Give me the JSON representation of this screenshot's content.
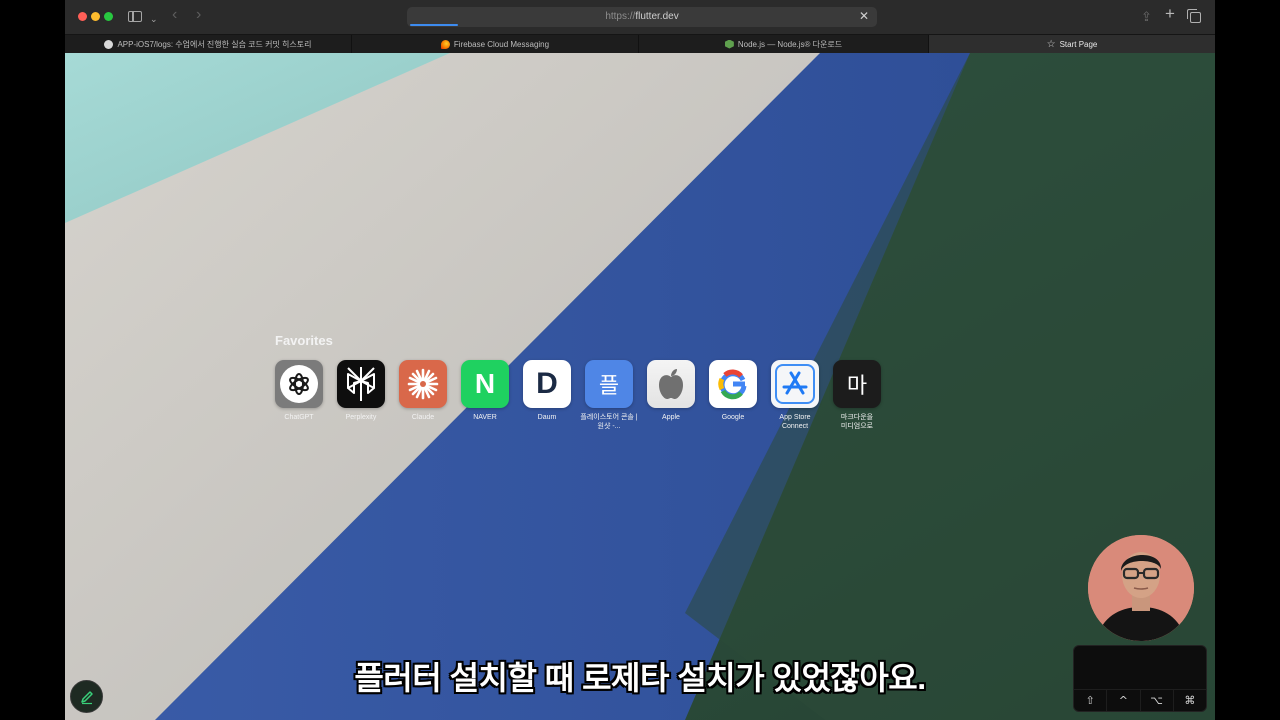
{
  "browser": {
    "address": {
      "scheme": "https://",
      "host": "flutter.dev"
    },
    "tabs": [
      {
        "label": "APP-iOS7/logs: 수업에서 진행한 실습 코드 커밋 히스토리",
        "icon": "github-icon"
      },
      {
        "label": "Firebase Cloud Messaging",
        "icon": "firebase-icon"
      },
      {
        "label": "Node.js — Node.js® 다운로드",
        "icon": "nodejs-icon"
      },
      {
        "label": "Start Page",
        "icon": "star-icon",
        "active": true
      }
    ]
  },
  "start_page": {
    "favorites_title": "Favorites",
    "favorites": [
      {
        "label": "ChatGPT",
        "icon": "chatgpt-icon"
      },
      {
        "label": "Perplexity",
        "icon": "perplexity-icon"
      },
      {
        "label": "Claude",
        "icon": "claude-icon"
      },
      {
        "label": "NAVER",
        "icon": "naver-icon",
        "glyph": "N"
      },
      {
        "label": "Daum",
        "icon": "daum-icon",
        "glyph": "D"
      },
      {
        "label": "플레이스토어 콘솔 | 원샷 -...",
        "icon": "playstore-console-icon",
        "glyph": "플"
      },
      {
        "label": "Apple",
        "icon": "apple-icon"
      },
      {
        "label": "Google",
        "icon": "google-icon",
        "glyph": "G"
      },
      {
        "label": "App Store Connect",
        "icon": "app-store-connect-icon"
      },
      {
        "label": "마크다운을 미디엄으로",
        "icon": "markdown-medium-icon",
        "glyph": "마"
      }
    ]
  },
  "video": {
    "subtitle": "플러터 설치할 때 로제타 설치가 있었잖아요."
  },
  "key_overlay": {
    "keys": [
      "⇧",
      "^",
      "⌥",
      "⌘"
    ]
  },
  "colors": {
    "wall_teal": "#9fd3cf",
    "wall_gray": "#c9c7c3",
    "wall_blue": "#3557a3",
    "wall_green": "#2b4a39",
    "accent_blue": "#3d8cf0"
  }
}
